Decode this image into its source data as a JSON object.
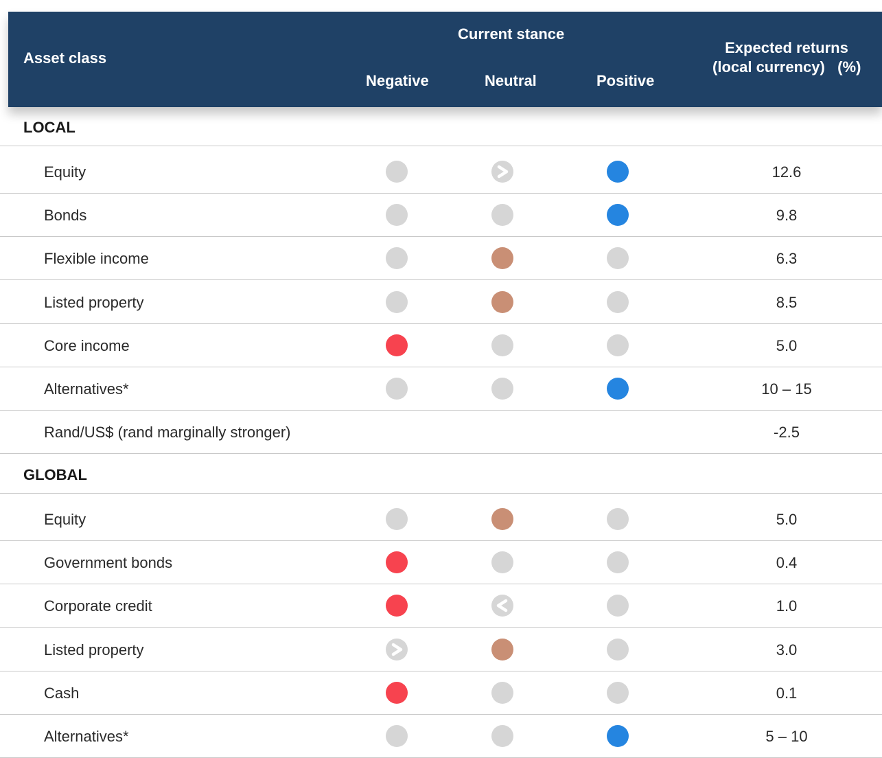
{
  "header": {
    "asset_class": "Asset class",
    "current_stance": "Current stance",
    "negative": "Negative",
    "neutral": "Neutral",
    "positive": "Positive",
    "expected_line1": "Expected returns",
    "expected_line2": "(local currency)   (%)"
  },
  "colors": {
    "header_bg": "#1f4166",
    "negative": "#f7434f",
    "neutral": "#c98f75",
    "positive": "#2585e0",
    "inactive": "#d6d6d6"
  },
  "sections": [
    {
      "title": "LOCAL",
      "rows": [
        {
          "label": "Equity",
          "stance": "positive",
          "arrow": {
            "col": "neutral",
            "dir": "right"
          },
          "ret": "12.6"
        },
        {
          "label": "Bonds",
          "stance": "positive",
          "arrow": null,
          "ret": "9.8"
        },
        {
          "label": "Flexible income",
          "stance": "neutral",
          "arrow": null,
          "ret": "6.3"
        },
        {
          "label": "Listed property",
          "stance": "neutral",
          "arrow": null,
          "ret": "8.5"
        },
        {
          "label": "Core income",
          "stance": "negative",
          "arrow": null,
          "ret": "5.0"
        },
        {
          "label": "Alternatives*",
          "stance": "positive",
          "arrow": null,
          "ret": "10 – 15"
        },
        {
          "label": "Rand/US$ (rand marginally stronger)",
          "stance": null,
          "arrow": null,
          "ret": "-2.5"
        }
      ]
    },
    {
      "title": "GLOBAL",
      "rows": [
        {
          "label": "Equity",
          "stance": "neutral",
          "arrow": null,
          "ret": "5.0"
        },
        {
          "label": "Government bonds",
          "stance": "negative",
          "arrow": null,
          "ret": "0.4"
        },
        {
          "label": "Corporate credit",
          "stance": "negative",
          "arrow": {
            "col": "neutral",
            "dir": "left"
          },
          "ret": "1.0"
        },
        {
          "label": "Listed property",
          "stance": "neutral",
          "arrow": {
            "col": "negative",
            "dir": "right"
          },
          "ret": "3.0"
        },
        {
          "label": "Cash",
          "stance": "negative",
          "arrow": null,
          "ret": "0.1"
        },
        {
          "label": "Alternatives*",
          "stance": "positive",
          "arrow": null,
          "ret": "5 – 10"
        }
      ]
    }
  ]
}
